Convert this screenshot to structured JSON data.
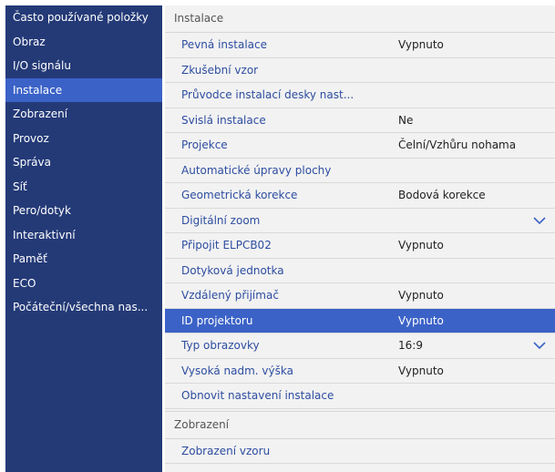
{
  "sidebar": {
    "items": [
      {
        "label": "Často používané položky",
        "active": false
      },
      {
        "label": "Obraz",
        "active": false
      },
      {
        "label": "I/O signálu",
        "active": false
      },
      {
        "label": "Instalace",
        "active": true
      },
      {
        "label": "Zobrazení",
        "active": false
      },
      {
        "label": "Provoz",
        "active": false
      },
      {
        "label": "Správa",
        "active": false
      },
      {
        "label": "Síť",
        "active": false
      },
      {
        "label": "Pero/dotyk",
        "active": false
      },
      {
        "label": "Interaktivní",
        "active": false
      },
      {
        "label": "Paměť",
        "active": false
      },
      {
        "label": "ECO",
        "active": false
      },
      {
        "label": "Počáteční/všechna nas...",
        "active": false
      }
    ]
  },
  "main": {
    "section1_title": "Instalace",
    "rows": [
      {
        "label": "Pevná instalace",
        "value": "Vypnuto"
      },
      {
        "label": "Zkušební vzor",
        "value": ""
      },
      {
        "label": "Průvodce instalací desky nast...",
        "value": ""
      },
      {
        "label": "Svislá instalace",
        "value": "Ne"
      },
      {
        "label": "Projekce",
        "value": "Čelní/Vzhůru nohama"
      },
      {
        "label": "Automatické úpravy plochy",
        "value": ""
      },
      {
        "label": "Geometrická korekce",
        "value": "Bodová korekce"
      },
      {
        "label": "Digitální zoom",
        "value": "",
        "chevron": true
      },
      {
        "label": "Připojit ELPCB02",
        "value": "Vypnuto"
      },
      {
        "label": "Dotyková jednotka",
        "value": ""
      },
      {
        "label": "Vzdálený přijímač",
        "value": "Vypnuto"
      },
      {
        "label": "ID projektoru",
        "value": "Vypnuto",
        "selected": true
      },
      {
        "label": "Typ obrazovky",
        "value": "16:9",
        "chevron": true
      },
      {
        "label": "Vysoká nadm. výška",
        "value": "Vypnuto"
      },
      {
        "label": "Obnovit nastavení instalace",
        "value": ""
      }
    ],
    "section2_title": "Zobrazení",
    "section2_rows": [
      {
        "label": "Zobrazení vzoru",
        "value": ""
      }
    ]
  },
  "colors": {
    "sidebar_bg": "#243a77",
    "selected_bg": "#3b62c7",
    "main_bg": "#f2f2f2",
    "label_text": "#2d4da0"
  },
  "icons": {
    "chevron": "chevron-down-icon"
  }
}
